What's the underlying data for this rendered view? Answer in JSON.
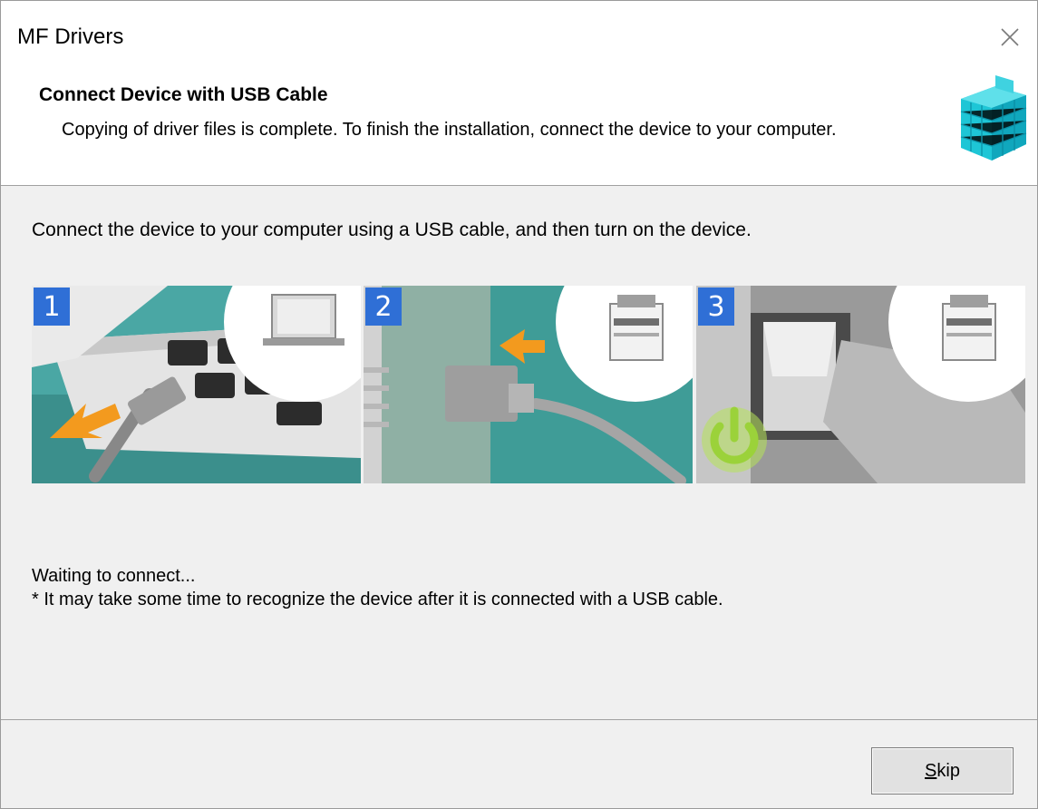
{
  "window": {
    "title": "MF Drivers"
  },
  "header": {
    "title": "Connect Device with USB Cable",
    "subtitle": "Copying of driver files is complete. To finish the installation, connect the device to your computer.",
    "logo_icon": "cube-installer-icon"
  },
  "main": {
    "instruction": "Connect the device to your computer using a USB cable, and then turn on the device.",
    "steps": [
      {
        "number": "1",
        "icon": "laptop-usb-illustration"
      },
      {
        "number": "2",
        "icon": "printer-usb-illustration"
      },
      {
        "number": "3",
        "icon": "power-switch-illustration"
      }
    ],
    "status": "Waiting to connect...",
    "note": "* It may take some time to recognize the device after it is connected with a USB cable."
  },
  "footer": {
    "skip_label_accel": "S",
    "skip_label_rest": "kip"
  },
  "colors": {
    "badge": "#2f6fd6",
    "teal": "#2f8f8a",
    "power_green": "#9bd23a",
    "arrow_orange": "#f39a1e"
  }
}
